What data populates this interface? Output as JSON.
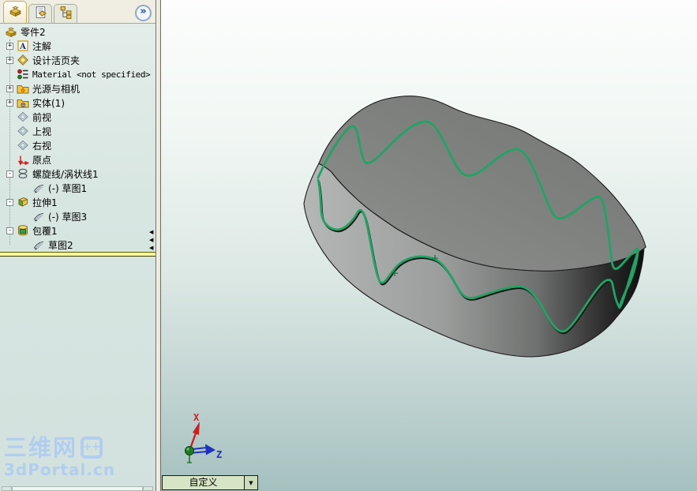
{
  "panel": {
    "expand_glyph": "»",
    "tabs": [
      {
        "name": "featuremanager",
        "icon": "part",
        "active": true
      },
      {
        "name": "propertymanager",
        "icon": "property",
        "active": false
      },
      {
        "name": "configurationmanager",
        "icon": "config",
        "active": false
      }
    ],
    "tree": [
      {
        "name": "part2",
        "icon": "part",
        "label": "零件2",
        "level": 0,
        "expand": ""
      },
      {
        "name": "annotations",
        "icon": "annotations",
        "label": "注解",
        "level": 1,
        "expand": "+"
      },
      {
        "name": "design-binder",
        "icon": "binder",
        "label": "设计活页夹",
        "level": 1,
        "expand": "+"
      },
      {
        "name": "material",
        "icon": "material",
        "label": "Material <not specified>",
        "level": 1,
        "expand": "",
        "mono": true
      },
      {
        "name": "lights-cameras",
        "icon": "lights",
        "label": "光源与相机",
        "level": 1,
        "expand": "+"
      },
      {
        "name": "solid-bodies",
        "icon": "bodies",
        "label": "实体(1)",
        "level": 1,
        "expand": "+"
      },
      {
        "name": "front-plane",
        "icon": "plane",
        "label": "前视",
        "level": 1,
        "expand": ""
      },
      {
        "name": "top-plane",
        "icon": "plane",
        "label": "上视",
        "level": 1,
        "expand": ""
      },
      {
        "name": "right-plane",
        "icon": "plane",
        "label": "右视",
        "level": 1,
        "expand": ""
      },
      {
        "name": "origin",
        "icon": "origin",
        "label": "原点",
        "level": 1,
        "expand": ""
      },
      {
        "name": "helix-spiral1",
        "icon": "helix",
        "label": "螺旋线/涡状线1",
        "level": 1,
        "expand": "-"
      },
      {
        "name": "sketch1",
        "icon": "sketch",
        "label": "(-) 草图1",
        "level": 2,
        "expand": ""
      },
      {
        "name": "extrude1",
        "icon": "extrude",
        "label": "拉伸1",
        "level": 1,
        "expand": "-"
      },
      {
        "name": "sketch3",
        "icon": "sketch",
        "label": "(-) 草图3",
        "level": 2,
        "expand": ""
      },
      {
        "name": "wrap1",
        "icon": "wrap",
        "label": "包覆1",
        "level": 1,
        "expand": "-"
      },
      {
        "name": "sketch2",
        "icon": "sketch",
        "label": "草图2",
        "level": 2,
        "expand": ""
      }
    ]
  },
  "viewport": {
    "combo_value": "自定义",
    "combo_caret": "▼",
    "triad": {
      "x_label": "X",
      "z_label": "Z"
    }
  },
  "watermark": {
    "line1": "三维网",
    "logo_glyph": "++",
    "line2": "3dPortal.cn"
  },
  "colors": {
    "curve_green": "#22a366",
    "rollback_yellow": "#ffff9c",
    "viewport_top": "#fcfdfc",
    "viewport_bottom": "#a4c0bf",
    "panel_bg": "#d9e6e2",
    "combo_bg": "#d7e5c6",
    "watermark_blue": "#b2cdf0",
    "model_top_gray": "#7f817f",
    "model_side_dark": "#0d0d0d"
  }
}
